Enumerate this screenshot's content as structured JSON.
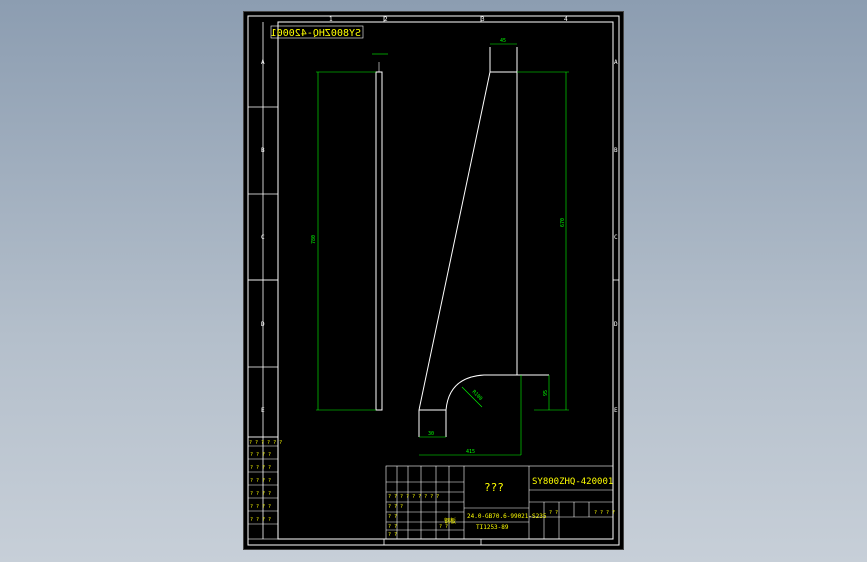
{
  "drawing": {
    "title_top_mirrored": "SY800ZHQ-420001",
    "title_block_name": "???",
    "title_block_code": "SY800ZHQ-420001",
    "material_line1": "24.0-GB70.6-99021-S235",
    "material_line2": "TI1253-89",
    "part_label": "钢板",
    "zone_letters": [
      "A",
      "B",
      "C",
      "D",
      "E"
    ],
    "grid_numbers": [
      "1",
      "2",
      "3",
      "4"
    ],
    "dims": {
      "top_width": "45",
      "rect_height": "780",
      "plate_height": "670",
      "bottom_width": "415",
      "radius": "R100",
      "bottom_small": "30",
      "right_low": "95"
    },
    "marker": "?",
    "colors": {
      "border": "#ffffff",
      "geometry": "#ffffff",
      "dimension": "#00ff00",
      "title_text": "#ffff00",
      "sheet": "#000000"
    }
  }
}
